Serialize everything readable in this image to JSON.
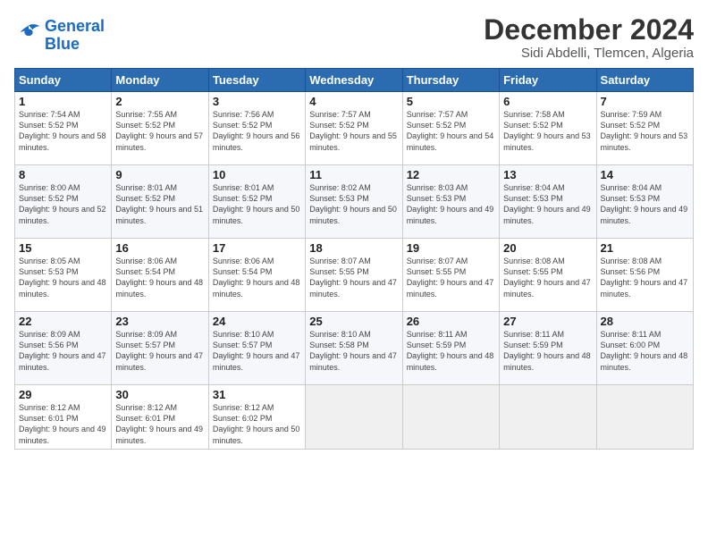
{
  "header": {
    "logo_line1": "General",
    "logo_line2": "Blue",
    "title": "December 2024",
    "subtitle": "Sidi Abdelli, Tlemcen, Algeria"
  },
  "weekdays": [
    "Sunday",
    "Monday",
    "Tuesday",
    "Wednesday",
    "Thursday",
    "Friday",
    "Saturday"
  ],
  "weeks": [
    [
      {
        "day": "1",
        "sunrise": "7:54 AM",
        "sunset": "5:52 PM",
        "daylight": "9 hours and 58 minutes."
      },
      {
        "day": "2",
        "sunrise": "7:55 AM",
        "sunset": "5:52 PM",
        "daylight": "9 hours and 57 minutes."
      },
      {
        "day": "3",
        "sunrise": "7:56 AM",
        "sunset": "5:52 PM",
        "daylight": "9 hours and 56 minutes."
      },
      {
        "day": "4",
        "sunrise": "7:57 AM",
        "sunset": "5:52 PM",
        "daylight": "9 hours and 55 minutes."
      },
      {
        "day": "5",
        "sunrise": "7:57 AM",
        "sunset": "5:52 PM",
        "daylight": "9 hours and 54 minutes."
      },
      {
        "day": "6",
        "sunrise": "7:58 AM",
        "sunset": "5:52 PM",
        "daylight": "9 hours and 53 minutes."
      },
      {
        "day": "7",
        "sunrise": "7:59 AM",
        "sunset": "5:52 PM",
        "daylight": "9 hours and 53 minutes."
      }
    ],
    [
      {
        "day": "8",
        "sunrise": "8:00 AM",
        "sunset": "5:52 PM",
        "daylight": "9 hours and 52 minutes."
      },
      {
        "day": "9",
        "sunrise": "8:01 AM",
        "sunset": "5:52 PM",
        "daylight": "9 hours and 51 minutes."
      },
      {
        "day": "10",
        "sunrise": "8:01 AM",
        "sunset": "5:52 PM",
        "daylight": "9 hours and 50 minutes."
      },
      {
        "day": "11",
        "sunrise": "8:02 AM",
        "sunset": "5:53 PM",
        "daylight": "9 hours and 50 minutes."
      },
      {
        "day": "12",
        "sunrise": "8:03 AM",
        "sunset": "5:53 PM",
        "daylight": "9 hours and 49 minutes."
      },
      {
        "day": "13",
        "sunrise": "8:04 AM",
        "sunset": "5:53 PM",
        "daylight": "9 hours and 49 minutes."
      },
      {
        "day": "14",
        "sunrise": "8:04 AM",
        "sunset": "5:53 PM",
        "daylight": "9 hours and 49 minutes."
      }
    ],
    [
      {
        "day": "15",
        "sunrise": "8:05 AM",
        "sunset": "5:53 PM",
        "daylight": "9 hours and 48 minutes."
      },
      {
        "day": "16",
        "sunrise": "8:06 AM",
        "sunset": "5:54 PM",
        "daylight": "9 hours and 48 minutes."
      },
      {
        "day": "17",
        "sunrise": "8:06 AM",
        "sunset": "5:54 PM",
        "daylight": "9 hours and 48 minutes."
      },
      {
        "day": "18",
        "sunrise": "8:07 AM",
        "sunset": "5:55 PM",
        "daylight": "9 hours and 47 minutes."
      },
      {
        "day": "19",
        "sunrise": "8:07 AM",
        "sunset": "5:55 PM",
        "daylight": "9 hours and 47 minutes."
      },
      {
        "day": "20",
        "sunrise": "8:08 AM",
        "sunset": "5:55 PM",
        "daylight": "9 hours and 47 minutes."
      },
      {
        "day": "21",
        "sunrise": "8:08 AM",
        "sunset": "5:56 PM",
        "daylight": "9 hours and 47 minutes."
      }
    ],
    [
      {
        "day": "22",
        "sunrise": "8:09 AM",
        "sunset": "5:56 PM",
        "daylight": "9 hours and 47 minutes."
      },
      {
        "day": "23",
        "sunrise": "8:09 AM",
        "sunset": "5:57 PM",
        "daylight": "9 hours and 47 minutes."
      },
      {
        "day": "24",
        "sunrise": "8:10 AM",
        "sunset": "5:57 PM",
        "daylight": "9 hours and 47 minutes."
      },
      {
        "day": "25",
        "sunrise": "8:10 AM",
        "sunset": "5:58 PM",
        "daylight": "9 hours and 47 minutes."
      },
      {
        "day": "26",
        "sunrise": "8:11 AM",
        "sunset": "5:59 PM",
        "daylight": "9 hours and 48 minutes."
      },
      {
        "day": "27",
        "sunrise": "8:11 AM",
        "sunset": "5:59 PM",
        "daylight": "9 hours and 48 minutes."
      },
      {
        "day": "28",
        "sunrise": "8:11 AM",
        "sunset": "6:00 PM",
        "daylight": "9 hours and 48 minutes."
      }
    ],
    [
      {
        "day": "29",
        "sunrise": "8:12 AM",
        "sunset": "6:01 PM",
        "daylight": "9 hours and 49 minutes."
      },
      {
        "day": "30",
        "sunrise": "8:12 AM",
        "sunset": "6:01 PM",
        "daylight": "9 hours and 49 minutes."
      },
      {
        "day": "31",
        "sunrise": "8:12 AM",
        "sunset": "6:02 PM",
        "daylight": "9 hours and 50 minutes."
      },
      null,
      null,
      null,
      null
    ]
  ]
}
